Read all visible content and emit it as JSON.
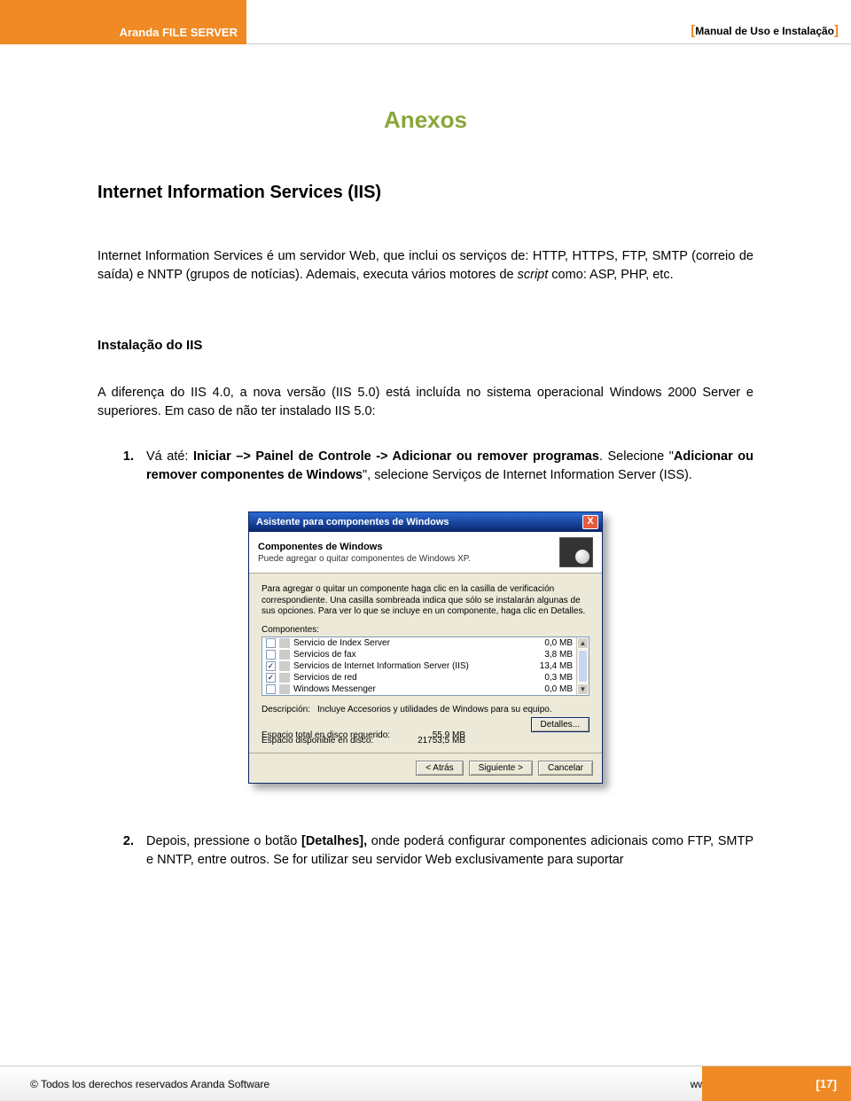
{
  "header": {
    "product": "Aranda FILE SERVER",
    "doc_label": "Manual de Uso e Instalação"
  },
  "body": {
    "title": "Anexos",
    "section1_title": "Internet Information Services (IIS)",
    "section1_p_pre": "Internet Information Services é um servidor Web, que inclui os serviços de: HTTP, HTTPS, FTP, SMTP (correio de saída) e NNTP (grupos de notícias). Ademais, executa vários motores de ",
    "section1_p_italic": "script",
    "section1_p_post": " como: ASP, PHP, etc.",
    "section2_title": "Instalação do IIS",
    "section2_p": "A diferença do IIS 4.0, a nova versão (IIS 5.0) está incluída no sistema operacional Windows 2000 Server e superiores. Em caso de não ter instalado IIS 5.0:",
    "item1": {
      "num": "1.",
      "pre": "Vá até: ",
      "bold1": "Iniciar –> Painel de Controle -> Adicionar ou remover programas",
      "mid": ".  Selecione \"",
      "bold2": "Adicionar ou remover componentes de Windows",
      "post": "\", selecione Serviços de Internet Information Server (ISS)."
    },
    "item2": {
      "num": "2.",
      "pre": "Depois, pressione o botão ",
      "bold": "[Detalhes],",
      "post": " onde poderá configurar componentes adicionais como FTP, SMTP e NNTP, entre outros. Se for utilizar seu servidor Web exclusivamente para suportar"
    }
  },
  "dialog": {
    "title": "Asistente para componentes de Windows",
    "close": "X",
    "band_title": "Componentes de Windows",
    "band_sub": "Puede agregar o quitar componentes de Windows XP.",
    "intro": "Para agregar o quitar un componente haga clic en la casilla de verificación correspondiente. Una casilla sombreada indica que sólo se instalarán algunas de sus opciones. Para ver lo que se incluye en un componente, haga clic en Detalles.",
    "components_label": "Componentes:",
    "rows": [
      {
        "checked": false,
        "name": "Servicio de Index Server",
        "size": "0,0 MB"
      },
      {
        "checked": false,
        "name": "Servicios de fax",
        "size": "3,8 MB"
      },
      {
        "checked": true,
        "name": "Servicios de Internet Information Server (IIS)",
        "size": "13,4 MB"
      },
      {
        "checked": true,
        "name": "Servicios de red",
        "size": "0,3 MB"
      },
      {
        "checked": false,
        "name": "Windows Messenger",
        "size": "0,0 MB"
      }
    ],
    "desc_label": "Descripción:",
    "desc_value": "Incluye Accesorios y utilidades de Windows para su equipo.",
    "space_total_label": "Espacio total en disco requerido:",
    "space_total_value": "55,9 MB",
    "space_free_label": "Espacio disponible en disco:",
    "space_free_value": "21753,5 MB",
    "btn_details": "Detalles...",
    "btn_back": "< Atrás",
    "btn_next": "Siguiente >",
    "btn_cancel": "Cancelar"
  },
  "footer": {
    "copyright": "© Todos los derechos reservados Aranda Software",
    "url": "www.arandasoft.com",
    "page": "17"
  }
}
